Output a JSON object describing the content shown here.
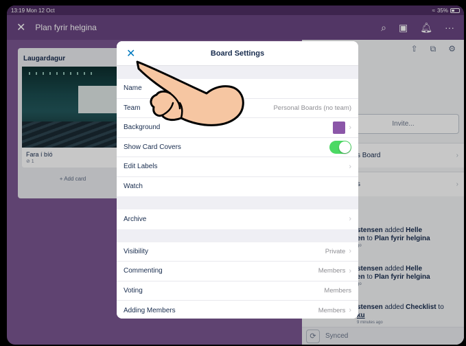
{
  "status": {
    "time": "13:19",
    "date": "Mon 12 Oct",
    "battery": "35%"
  },
  "nav": {
    "title": "Plan fyrir helgina",
    "close_glyph": "✕",
    "search_glyph": "⌕",
    "board_glyph": "▣",
    "bell_glyph": "♫",
    "more_glyph": "···"
  },
  "list": {
    "title": "Laugardagur",
    "card": {
      "title": "Fara í bíó",
      "badge": "⊘ 1"
    },
    "add_card": "+ Add card"
  },
  "right_panel": {
    "icons": {
      "share": "⇧",
      "copy": "⧉",
      "settings": "⚙"
    },
    "invite_placeholder": "Invite...",
    "rows": [
      "s Board",
      "s"
    ],
    "activities": [
      {
        "actor": "stensen",
        "text1": " added ",
        "target": "Helle",
        "line2a": "en",
        "line2b": " to ",
        "board": "Plan fyrir helgina",
        "ago": "go"
      },
      {
        "actor": "stensen",
        "text1": " added ",
        "target": "Helle",
        "line2a": "en",
        "line2b": " to ",
        "board": "Plan fyrir helgina",
        "ago": "go"
      },
      {
        "actor": "stensen",
        "text1": " added ",
        "target": "Checklist",
        "text2": " to",
        "line2a": "ku",
        "ago": "9 minutes ago"
      }
    ],
    "synced_label": "Synced"
  },
  "modal": {
    "title": "Board Settings",
    "close_glyph": "✕",
    "group1": {
      "name_label": "Name",
      "team_label": "Team",
      "team_value": "Personal Boards (no team)",
      "background_label": "Background",
      "background_color": "#8b56a8",
      "card_covers_label": "Show Card Covers",
      "card_covers_on": true,
      "labels_label": "Edit Labels",
      "watch_label": "Watch"
    },
    "group2": {
      "archive_label": "Archive"
    },
    "group3": {
      "visibility_label": "Visibility",
      "visibility_value": "Private",
      "commenting_label": "Commenting",
      "commenting_value": "Members",
      "voting_label": "Voting",
      "voting_value": "Members",
      "adding_label": "Adding Members",
      "adding_value": "Members"
    }
  },
  "chevron": "›"
}
